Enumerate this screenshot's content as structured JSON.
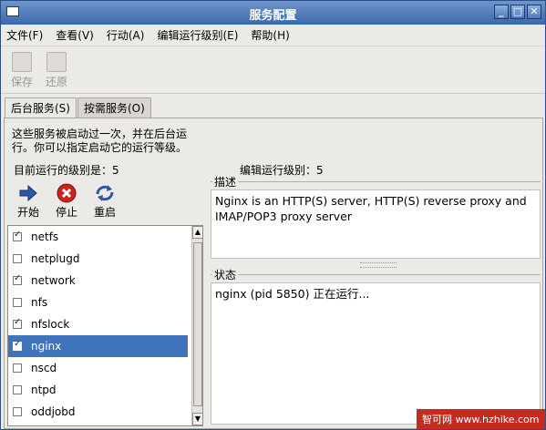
{
  "window": {
    "title": "服务配置"
  },
  "menubar": {
    "items": [
      "文件(F)",
      "查看(V)",
      "行动(A)",
      "编辑运行级别(E)",
      "帮助(H)"
    ]
  },
  "toolbar": {
    "save_label": "保存",
    "revert_label": "还原"
  },
  "tabs": [
    {
      "label": "后台服务(S)",
      "active": true
    },
    {
      "label": "按需服务(O)",
      "active": false
    }
  ],
  "panel": {
    "intro_line1": "这些服务被启动过一次，并在后台运",
    "intro_line2": "行。你可以指定启动它的运行等级。",
    "current_runlevel": "目前运行的级别是：5",
    "edit_runlevel": "编辑运行级别：5",
    "actions": {
      "start": "开始",
      "stop": "停止",
      "restart": "重启"
    }
  },
  "services": [
    {
      "name": "netfs",
      "checked": true,
      "selected": false
    },
    {
      "name": "netplugd",
      "checked": false,
      "selected": false
    },
    {
      "name": "network",
      "checked": true,
      "selected": false
    },
    {
      "name": "nfs",
      "checked": false,
      "selected": false
    },
    {
      "name": "nfslock",
      "checked": true,
      "selected": false
    },
    {
      "name": "nginx",
      "checked": true,
      "selected": true
    },
    {
      "name": "nscd",
      "checked": false,
      "selected": false
    },
    {
      "name": "ntpd",
      "checked": false,
      "selected": false
    },
    {
      "name": "oddjobd",
      "checked": false,
      "selected": false
    }
  ],
  "description": {
    "title": "描述",
    "text_line1": "Nginx is an HTTP(S) server, HTTP(S) reverse proxy and",
    "text_line2": "IMAP/POP3 proxy server"
  },
  "status": {
    "title": "状态",
    "text": "nginx (pid  5850) 正在运行..."
  },
  "watermark": {
    "text": "智可网 www.hzhike.com"
  },
  "colors": {
    "selection": "#3f74bd",
    "titlebar": "#4a78b8",
    "stop_icon": "#c8251e",
    "start_icon": "#2d58a8"
  }
}
